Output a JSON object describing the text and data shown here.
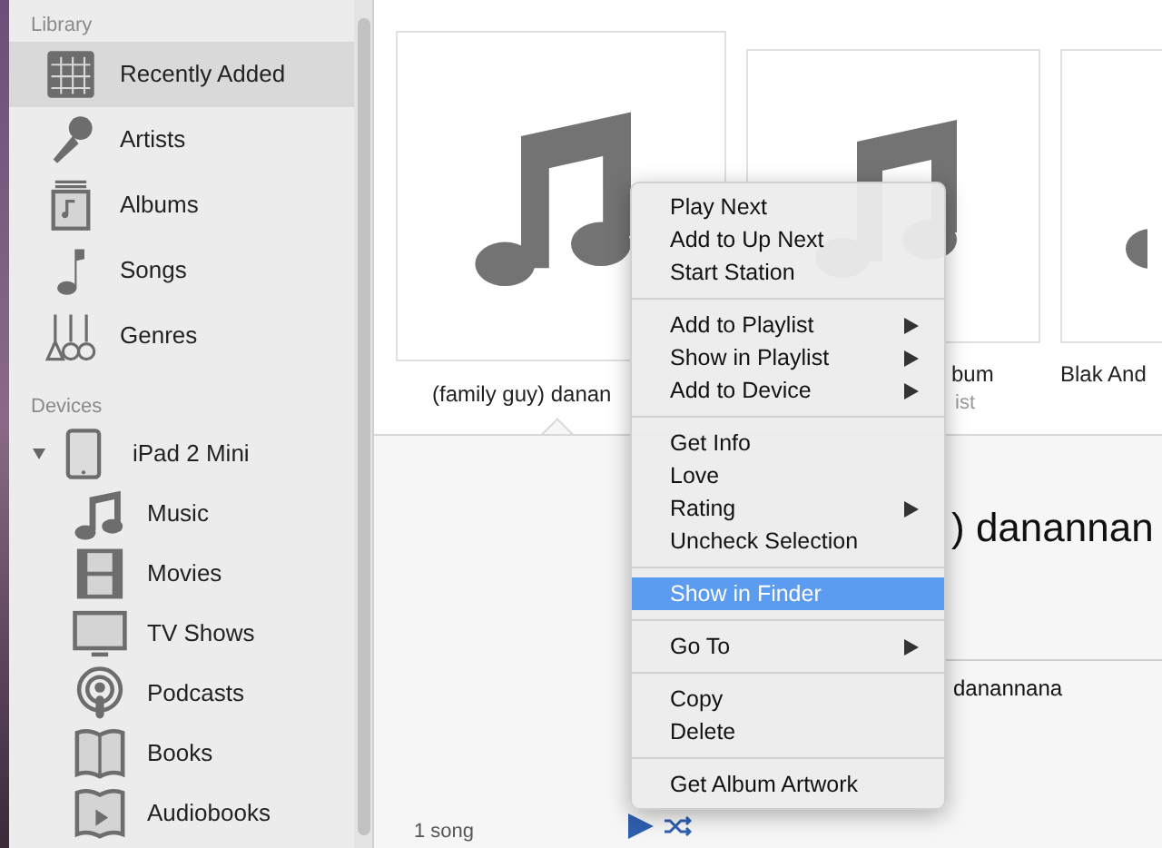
{
  "sidebar": {
    "library": {
      "title": "Library",
      "items": [
        {
          "label": "Recently Added",
          "selected": true
        },
        {
          "label": "Artists",
          "selected": false
        },
        {
          "label": "Albums",
          "selected": false
        },
        {
          "label": "Songs",
          "selected": false
        },
        {
          "label": "Genres",
          "selected": false
        }
      ]
    },
    "devices": {
      "title": "Devices",
      "items": [
        {
          "label": "iPad 2 Mini",
          "expanded": true,
          "children": [
            {
              "label": "Music"
            },
            {
              "label": "Movies"
            },
            {
              "label": "TV Shows"
            },
            {
              "label": "Podcasts"
            },
            {
              "label": "Books"
            },
            {
              "label": "Audiobooks"
            }
          ]
        }
      ]
    }
  },
  "albums": [
    {
      "title": "(family guy) danan",
      "selected": true
    },
    {
      "title": "bum",
      "subtitle": "ist",
      "selected": false
    },
    {
      "title": "Blak And",
      "selected": false
    }
  ],
  "detail": {
    "title": ") danannan",
    "track": "danannana",
    "song_count": "1 song"
  },
  "context_menu": {
    "groups": [
      [
        {
          "label": "Play Next",
          "submenu": false,
          "selected": false
        },
        {
          "label": "Add to Up Next",
          "submenu": false,
          "selected": false
        },
        {
          "label": "Start Station",
          "submenu": false,
          "selected": false
        }
      ],
      [
        {
          "label": "Add to Playlist",
          "submenu": true,
          "selected": false
        },
        {
          "label": "Show in Playlist",
          "submenu": true,
          "selected": false
        },
        {
          "label": "Add to Device",
          "submenu": true,
          "selected": false
        }
      ],
      [
        {
          "label": "Get Info",
          "submenu": false,
          "selected": false
        },
        {
          "label": "Love",
          "submenu": false,
          "selected": false
        },
        {
          "label": "Rating",
          "submenu": true,
          "selected": false
        },
        {
          "label": "Uncheck Selection",
          "submenu": false,
          "selected": false
        }
      ],
      [
        {
          "label": "Show in Finder",
          "submenu": false,
          "selected": true
        }
      ],
      [
        {
          "label": "Go To",
          "submenu": true,
          "selected": false
        }
      ],
      [
        {
          "label": "Copy",
          "submenu": false,
          "selected": false
        },
        {
          "label": "Delete",
          "submenu": false,
          "selected": false
        }
      ],
      [
        {
          "label": "Get Album Artwork",
          "submenu": false,
          "selected": false
        }
      ]
    ]
  }
}
